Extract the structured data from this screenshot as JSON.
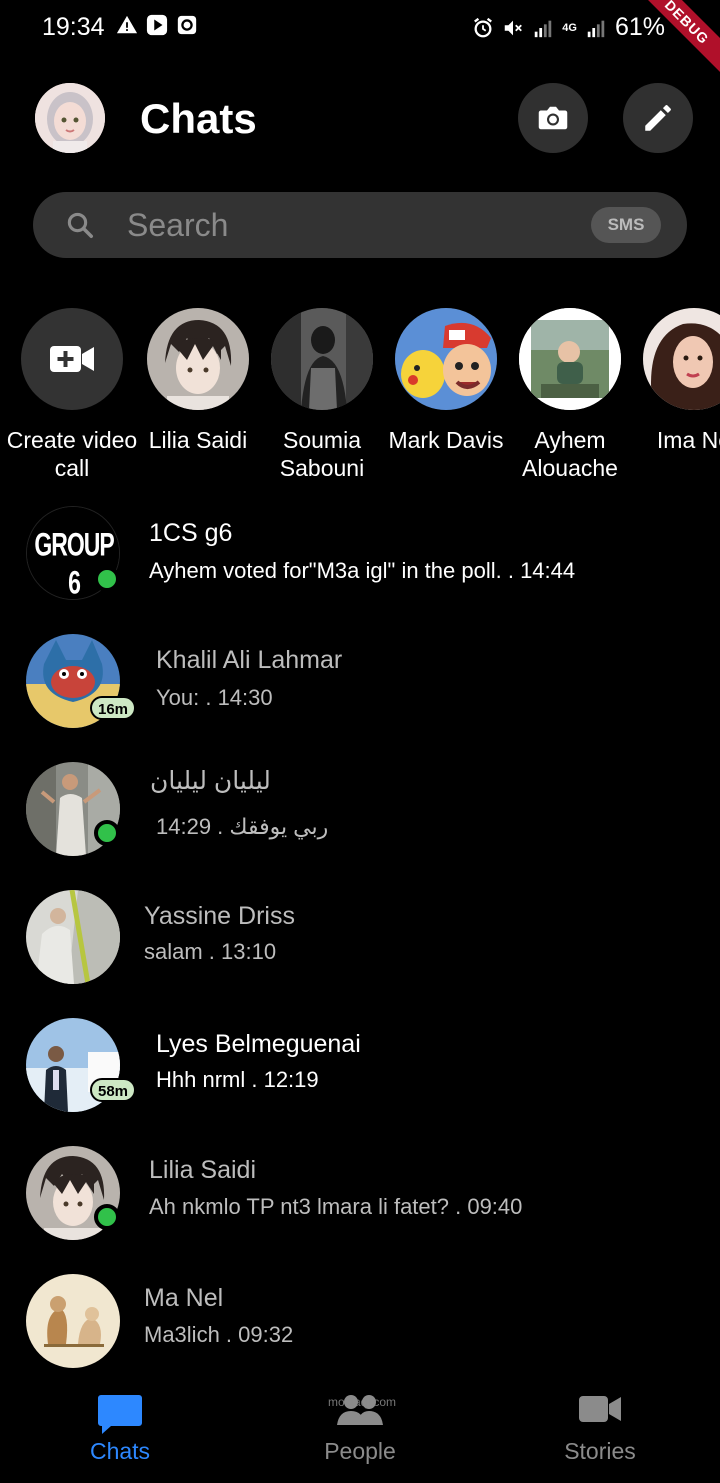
{
  "status_bar": {
    "time": "19:34",
    "battery": "61%",
    "network": "4G",
    "debug_label": "DEBUG"
  },
  "header": {
    "title": "Chats",
    "camera_icon": "camera-icon",
    "compose_icon": "pencil-icon"
  },
  "search": {
    "placeholder": "Search",
    "sms_badge": "SMS"
  },
  "stories": [
    {
      "label": "Create video call"
    },
    {
      "label": "Lilia Saidi"
    },
    {
      "label": "Soumia Sabouni"
    },
    {
      "label": "Mark Davis"
    },
    {
      "label": "Ayhem Alouache"
    },
    {
      "label": "Ima No"
    }
  ],
  "chats": [
    {
      "name": "1CS g6",
      "preview": "Ayhem voted for\"M3a igl\" in the poll. . 14:44",
      "online": true,
      "avatar_text": "GROUP 6"
    },
    {
      "name": "Khalil Ali Lahmar",
      "preview": "You:   . 14:30",
      "badge": "16m"
    },
    {
      "name": "ليليان ليليان",
      "preview": "ربي يوفقك . 14:29",
      "online": true
    },
    {
      "name": "Yassine Driss",
      "preview": "salam . 13:10"
    },
    {
      "name": "Lyes Belmeguenai",
      "preview": "Hhh nrml . 12:19",
      "badge": "58m"
    },
    {
      "name": "Lilia Saidi",
      "preview": "Ah nkmlo TP nt3 lmara li fatet? . 09:40",
      "online": true
    },
    {
      "name": "Ma Nel",
      "preview": "Ma3lich . 09:32"
    }
  ],
  "nav": {
    "chats": "Chats",
    "people": "People",
    "stories": "Stories"
  },
  "watermark": "mostaql.com",
  "colors": {
    "accent": "#2d88ff",
    "online": "#31c14a",
    "background": "#000000",
    "surface": "#333333"
  }
}
